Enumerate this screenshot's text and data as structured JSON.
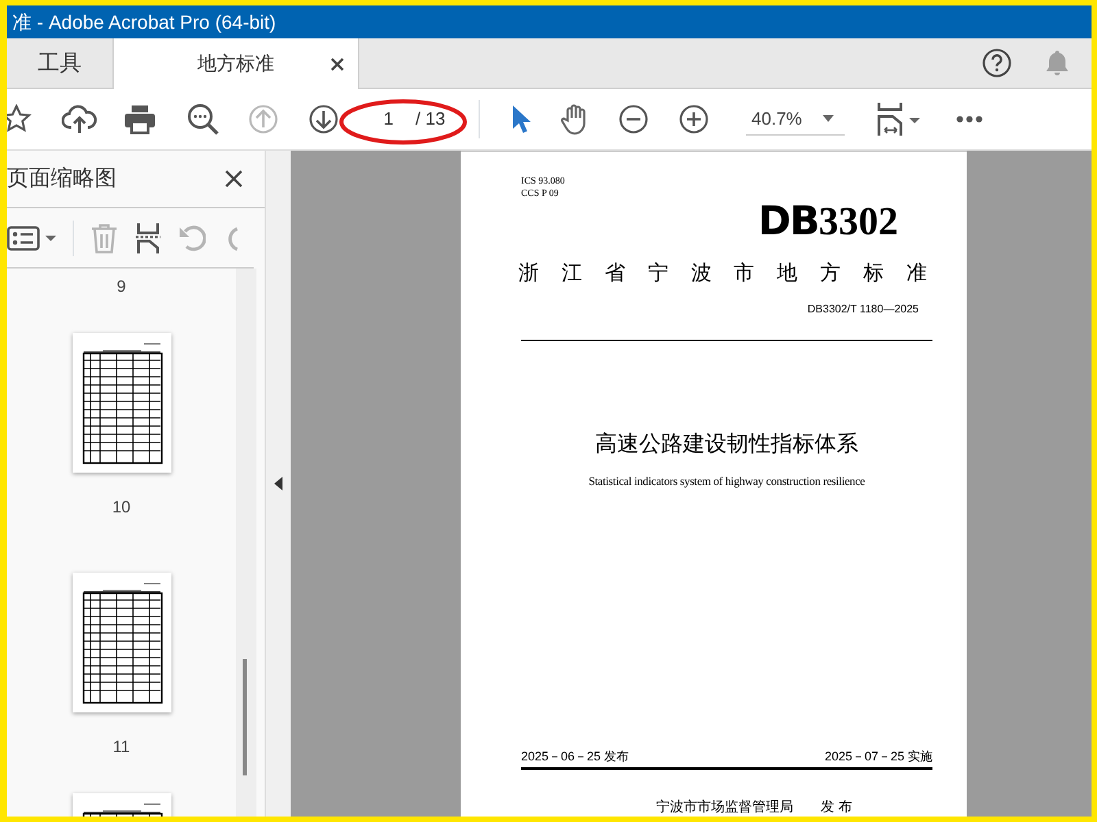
{
  "window": {
    "title": "准 - Adobe Acrobat Pro (64-bit)"
  },
  "tabs": [
    {
      "label": "工具",
      "selected": false,
      "closable": false
    },
    {
      "label": "地方标准",
      "selected": true,
      "closable": true
    }
  ],
  "toolbar": {
    "prev_page_disabled": true,
    "next_page_disabled": false,
    "page_number": "1",
    "page_count": "/ 13",
    "zoom": "40.7%",
    "tools": [
      {
        "selected": true
      },
      {
        "selected": false
      }
    ]
  },
  "thumbnail_panel": {
    "title": "页面缩略图",
    "top_label": "9",
    "pages": [
      {
        "label": "10"
      },
      {
        "label": "11"
      }
    ]
  },
  "document": {
    "ics": "ICS  93.080",
    "ccs": "CCS  P 09",
    "logo_prefix": "DB",
    "logo_number": "3302",
    "issuer_type": "浙江省宁波市地方标准",
    "standard_number": "DB3302/T 1180—2025",
    "title_zh": "高速公路建设韧性指标体系",
    "title_en": "Statistical indicators system of highway construction resilience",
    "issue_date": "2025－06－25 发布",
    "implement_date": "2025－07－25 实施",
    "publisher": "宁波市市场监督管理局",
    "publish_word": "发 布"
  }
}
